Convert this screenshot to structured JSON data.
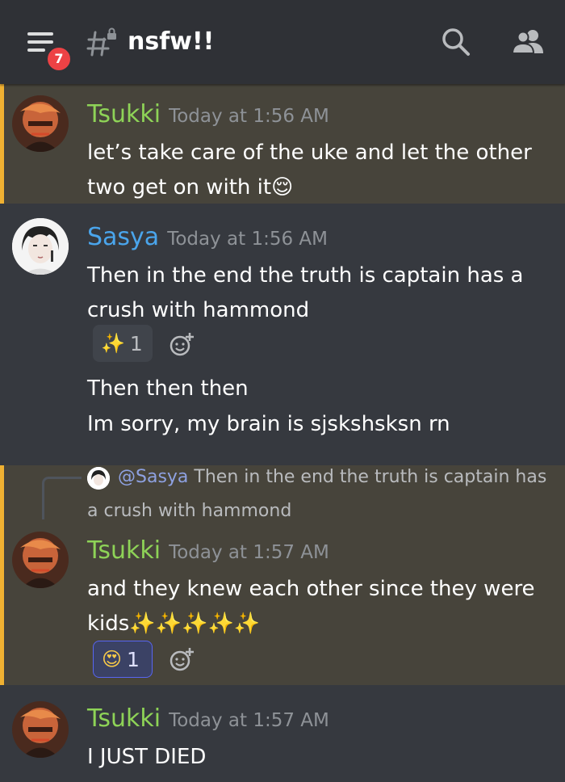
{
  "header": {
    "badge_count": "7",
    "channel_name": "nsfw!!",
    "icons": [
      "hamburger-menu-icon",
      "locked-hashtag-icon",
      "search-icon",
      "members-icon"
    ]
  },
  "messages": [
    {
      "author": "Tsukki",
      "timestamp": "Today at 1:56 AM",
      "lines": [
        "let’s take care of the uke and let the other",
        "two get on with it😌"
      ],
      "highlighted": true
    },
    {
      "author": "Sasya",
      "timestamp": "Today at 1:56 AM",
      "lines": [
        "Then in the end the truth is captain has a",
        "crush with hammond"
      ],
      "reaction": {
        "emoji": "✨",
        "count": "1"
      },
      "followups": [
        "Then then then",
        "Im sorry, my brain is sjskshsksn rn"
      ]
    },
    {
      "reply": {
        "mention": "@Sasya",
        "text_line1": "Then in the end the truth is captain has",
        "text_line2": "a crush with hammond"
      },
      "author": "Tsukki",
      "timestamp": "Today at 1:57 AM",
      "lines": [
        "and they knew each other since they were",
        "kids✨✨✨✨✨"
      ],
      "reaction": {
        "emoji": "😍",
        "count": "1"
      },
      "highlighted": true
    },
    {
      "author": "Tsukki",
      "timestamp": "Today at 1:57 AM",
      "lines": [
        "I JUST DIED"
      ]
    }
  ],
  "colors": {
    "background": "#36393f",
    "header": "#2f3136",
    "highlight": "#47443b",
    "highlight_bar": "#f0b132",
    "tsukki_name": "#8ed357",
    "sasya_name": "#4aa5ec"
  }
}
